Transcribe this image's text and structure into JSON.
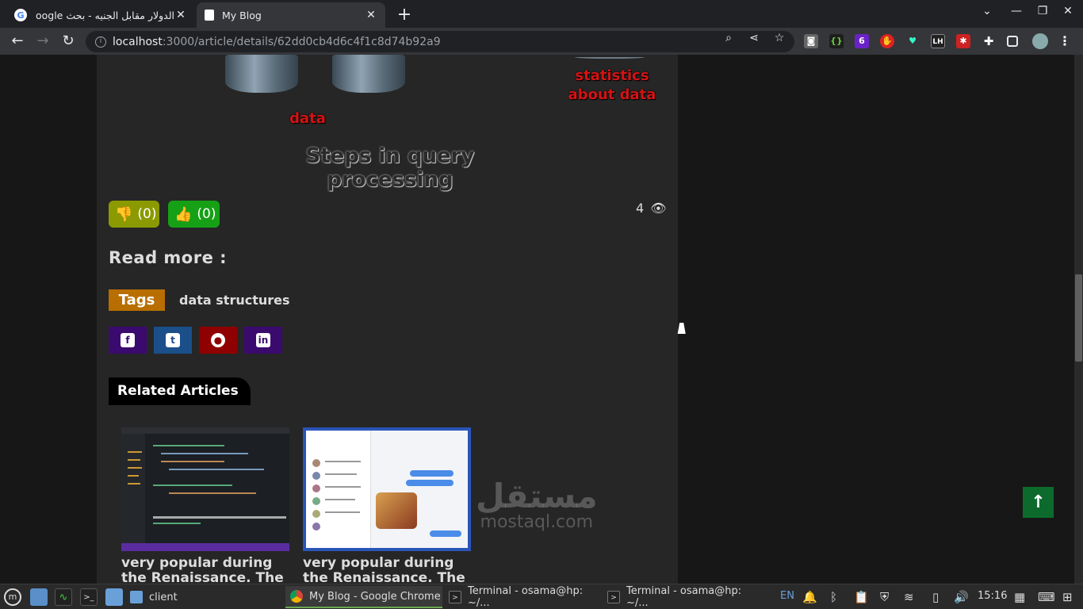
{
  "browser": {
    "tabs": [
      {
        "title": "الدولار مقابل الجنيه - بحث Google",
        "active": false
      },
      {
        "title": "My Blog",
        "active": true
      }
    ],
    "url_host": "localhost",
    "url_path": ":3000/article/details/62dd0cb4d6c4f1c8d74b92a9"
  },
  "figure": {
    "label_data": "data",
    "label_statistics": "statistics about data",
    "caption": "Steps in query processing"
  },
  "article": {
    "dislikes": "(0)",
    "likes": "(0)",
    "views": "4",
    "read_more": "Read more :",
    "tags_label": "Tags",
    "tags": [
      "data structures"
    ],
    "social": [
      "facebook",
      "twitter",
      "github",
      "linkedin"
    ],
    "social_colors": {
      "facebook": "#3b0a6e",
      "twitter": "#1a4f8a",
      "github": "#8f0000",
      "linkedin": "#3b0a6e"
    },
    "related_title": "Related Articles",
    "related": [
      {
        "title": "very popular during the Renaissance. The"
      },
      {
        "title": "very popular during the Renaissance. The"
      }
    ]
  },
  "watermark": {
    "ar": "مستقل",
    "en": "mostaql.com"
  },
  "taskbar": {
    "tasks": [
      {
        "label": "client"
      },
      {
        "label": "My Blog - Google Chrome"
      },
      {
        "label": "Terminal - osama@hp: ~/..."
      },
      {
        "label": "Terminal - osama@hp: ~/..."
      }
    ],
    "lang": "EN",
    "clock": "15:16"
  },
  "colors": {
    "accent_green": "#0c6b2c",
    "tag_orange": "#b86e00",
    "dislike": "#8a9a00",
    "like": "#16a016"
  }
}
